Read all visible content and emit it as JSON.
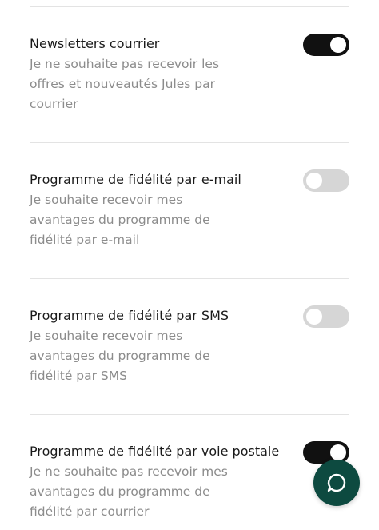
{
  "settings": [
    {
      "title": "Newsletters courrier",
      "description": "Je ne souhaite pas recevoir les offres et nouveautés Jules par courrier",
      "enabled": true
    },
    {
      "title": "Programme de fidélité par e-mail",
      "description": "Je souhaite recevoir mes avantages du programme de fidélité par e-mail",
      "enabled": false
    },
    {
      "title": "Programme de fidélité par SMS",
      "description": "Je souhaite recevoir mes avantages du programme de fidélité par SMS",
      "enabled": false
    },
    {
      "title": "Programme de fidélité par voie postale",
      "description": "Je ne souhaite pas recevoir mes avantages du programme de fidélité par courrier",
      "enabled": true
    }
  ],
  "colors": {
    "toggle_on": "#111111",
    "toggle_off": "#d6d6d6",
    "chat_button": "#0d4a40"
  },
  "chat_button": {
    "icon": "chat-bubble-icon"
  }
}
